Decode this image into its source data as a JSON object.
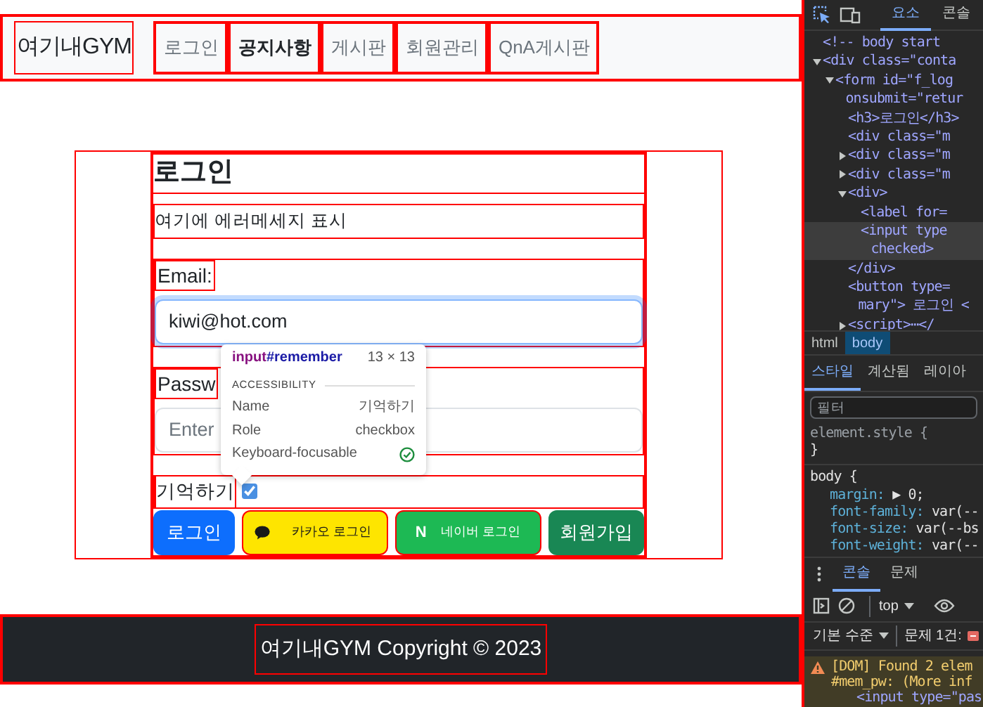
{
  "navbar": {
    "brand": "여기내GYM",
    "links": [
      {
        "label": "로그인",
        "selected": false
      },
      {
        "label": "공지사항",
        "selected": true
      },
      {
        "label": "게시판",
        "selected": false
      },
      {
        "label": "회원관리",
        "selected": false
      },
      {
        "label": "QnA게시판",
        "selected": false
      }
    ]
  },
  "login_form": {
    "title": "로그인",
    "error_message": "여기에 에러메세지 표시",
    "fields": [
      {
        "label": "Email:",
        "value": "kiwi@hot.com",
        "focused": true
      },
      {
        "label": "Passw",
        "placeholder": "Enter",
        "focused": false
      }
    ],
    "remember": {
      "label": "기억하기",
      "checked": true
    },
    "buttons": [
      {
        "kind": "primary",
        "label": "로그인"
      },
      {
        "kind": "kakao",
        "label": "카카오 로그인"
      },
      {
        "kind": "naver",
        "label": "네이버 로그인",
        "mark": "N"
      },
      {
        "kind": "signup",
        "label": "회원가입"
      }
    ]
  },
  "inspect_tooltip": {
    "tag": "input",
    "id": "#remember",
    "size": "13 × 13",
    "section": "ACCESSIBILITY",
    "rows": [
      {
        "key": "Name",
        "value": "기억하기"
      },
      {
        "key": "Role",
        "value": "checkbox"
      },
      {
        "key": "Keyboard-focusable",
        "focusable": true
      }
    ]
  },
  "footer": {
    "text": "여기내GYM Copyright © 2023"
  },
  "devtools": {
    "tabs": [
      {
        "label": "요소",
        "selected": true
      },
      {
        "label": "콘솔",
        "selected": false
      }
    ],
    "dom_tree": [
      {
        "text": "<!-- body start"
      },
      {
        "text": "<div class=\"conta",
        "expanded": true,
        "children": [
          {
            "text": "<form id=\"f_log",
            "continuation": "onsubmit=\"retur",
            "expanded": true,
            "children": [
              {
                "text": "<h3>로그인</h3>"
              },
              {
                "text": "<div class=\"m"
              },
              {
                "text": "<div class=\"m",
                "expanded": false
              },
              {
                "text": "<div class=\"m",
                "expanded": false
              },
              {
                "text": "<div>",
                "expanded": true,
                "closing": "</div>",
                "children": [
                  {
                    "text": "<label for="
                  },
                  {
                    "text": "<input type",
                    "continuation": "checked>",
                    "selected": true
                  }
                ]
              },
              {
                "text": "<button type=",
                "continuation": "mary\"> 로그인 <"
              },
              {
                "text": "<script>⋯</",
                "expanded": false
              }
            ]
          }
        ]
      }
    ],
    "breadcrumbs": [
      {
        "label": "html",
        "selected": false
      },
      {
        "label": "body",
        "selected": true
      }
    ],
    "style_tabs": [
      {
        "label": "스타일",
        "selected": true
      },
      {
        "label": "계산됨",
        "selected": false
      },
      {
        "label": "레이아",
        "selected": false
      }
    ],
    "filter_placeholder": "필터",
    "style_rules": [
      {
        "selector": "element.style {",
        "muted": true,
        "close": "}"
      },
      {
        "selector": "body {",
        "muted": false,
        "properties": [
          {
            "name": "margin:",
            "value": "▶ 0;"
          },
          {
            "name": "font-family:",
            "value": "var(--"
          },
          {
            "name": "font-size:",
            "value": "var(--bs"
          },
          {
            "name": "font-weight:",
            "value": "var(--"
          }
        ]
      }
    ],
    "drawer_tabs": [
      {
        "label": "콘솔",
        "selected": true
      },
      {
        "label": "문제",
        "selected": false
      }
    ],
    "context": "top",
    "log_level": "기본 수준",
    "issues": "문제 1건:",
    "warning": {
      "lines": [
        "[DOM] Found 2 elem",
        "#mem_pw: (More inf",
        "<input type=\"pas"
      ]
    }
  }
}
